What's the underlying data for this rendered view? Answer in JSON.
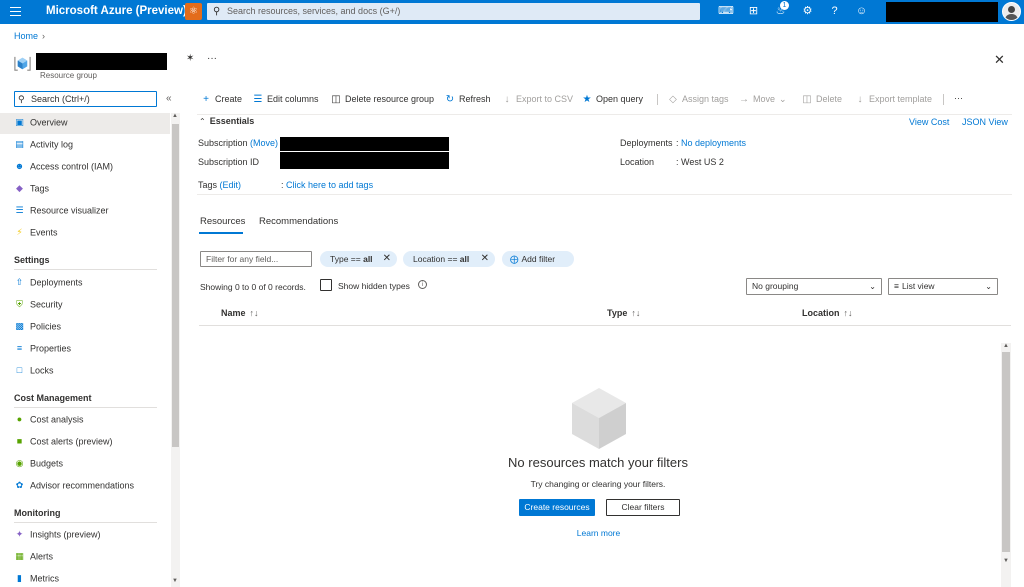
{
  "topbar": {
    "brand": "Microsoft Azure (Preview)",
    "search_placeholder": "Search resources, services, and docs (G+/)",
    "notification_count": "1"
  },
  "breadcrumb": {
    "home": "Home"
  },
  "resource": {
    "type_label": "Resource group"
  },
  "sidebar": {
    "search_placeholder": "Search (Ctrl+/)",
    "items": [
      {
        "label": "Overview",
        "icon": "overview-icon"
      },
      {
        "label": "Activity log",
        "icon": "activity-log-icon"
      },
      {
        "label": "Access control (IAM)",
        "icon": "people-icon"
      },
      {
        "label": "Tags",
        "icon": "tag-icon"
      },
      {
        "label": "Resource visualizer",
        "icon": "visualizer-icon"
      },
      {
        "label": "Events",
        "icon": "lightning-icon"
      }
    ],
    "settings": {
      "heading": "Settings",
      "items": [
        {
          "label": "Deployments",
          "icon": "upload-icon"
        },
        {
          "label": "Security",
          "icon": "shield-icon"
        },
        {
          "label": "Policies",
          "icon": "policy-icon"
        },
        {
          "label": "Properties",
          "icon": "properties-icon"
        },
        {
          "label": "Locks",
          "icon": "lock-icon"
        }
      ]
    },
    "cost": {
      "heading": "Cost Management",
      "items": [
        {
          "label": "Cost analysis",
          "icon": "cost-analysis-icon"
        },
        {
          "label": "Cost alerts (preview)",
          "icon": "cost-alert-icon"
        },
        {
          "label": "Budgets",
          "icon": "budget-icon"
        },
        {
          "label": "Advisor recommendations",
          "icon": "advisor-icon"
        }
      ]
    },
    "monitoring": {
      "heading": "Monitoring",
      "items": [
        {
          "label": "Insights (preview)",
          "icon": "insights-icon"
        },
        {
          "label": "Alerts",
          "icon": "alert-icon"
        },
        {
          "label": "Metrics",
          "icon": "metrics-icon"
        }
      ]
    }
  },
  "toolbar": {
    "create": "Create",
    "edit_columns": "Edit columns",
    "delete_rg": "Delete resource group",
    "refresh": "Refresh",
    "export_csv": "Export to CSV",
    "open_query": "Open query",
    "assign_tags": "Assign tags",
    "move": "Move",
    "delete": "Delete",
    "export_template": "Export template",
    "more": "···"
  },
  "essentials": {
    "title": "Essentials",
    "view_cost": "View Cost",
    "json_view": "JSON View",
    "subscription_label": "Subscription",
    "subscription_move": "(Move)",
    "subscription_id_label": "Subscription ID",
    "tags_label": "Tags",
    "tags_edit": "(Edit)",
    "tags_value": "Click here to add tags",
    "deployments_label": "Deployments",
    "deployments_value": "No deployments",
    "location_label": "Location",
    "location_value": "West US 2"
  },
  "tabs": {
    "resources": "Resources",
    "recommendations": "Recommendations"
  },
  "filters": {
    "placeholder": "Filter for any field...",
    "type_prefix": "Type == ",
    "type_value": "all",
    "location_prefix": "Location == ",
    "location_value": "all",
    "add_filter": "Add filter"
  },
  "records": {
    "showing": "Showing 0 to 0 of 0 records.",
    "show_hidden": "Show hidden types",
    "grouping": "No grouping",
    "view": "List view"
  },
  "table": {
    "col_name": "Name",
    "col_type": "Type",
    "col_location": "Location"
  },
  "empty": {
    "title": "No resources match your filters",
    "subtitle": "Try changing or clearing your filters.",
    "create_btn": "Create resources",
    "clear_btn": "Clear filters",
    "learn_more": "Learn more"
  },
  "colors": {
    "accent": "#0078d4",
    "sidebar_selected": "#edebe9"
  }
}
